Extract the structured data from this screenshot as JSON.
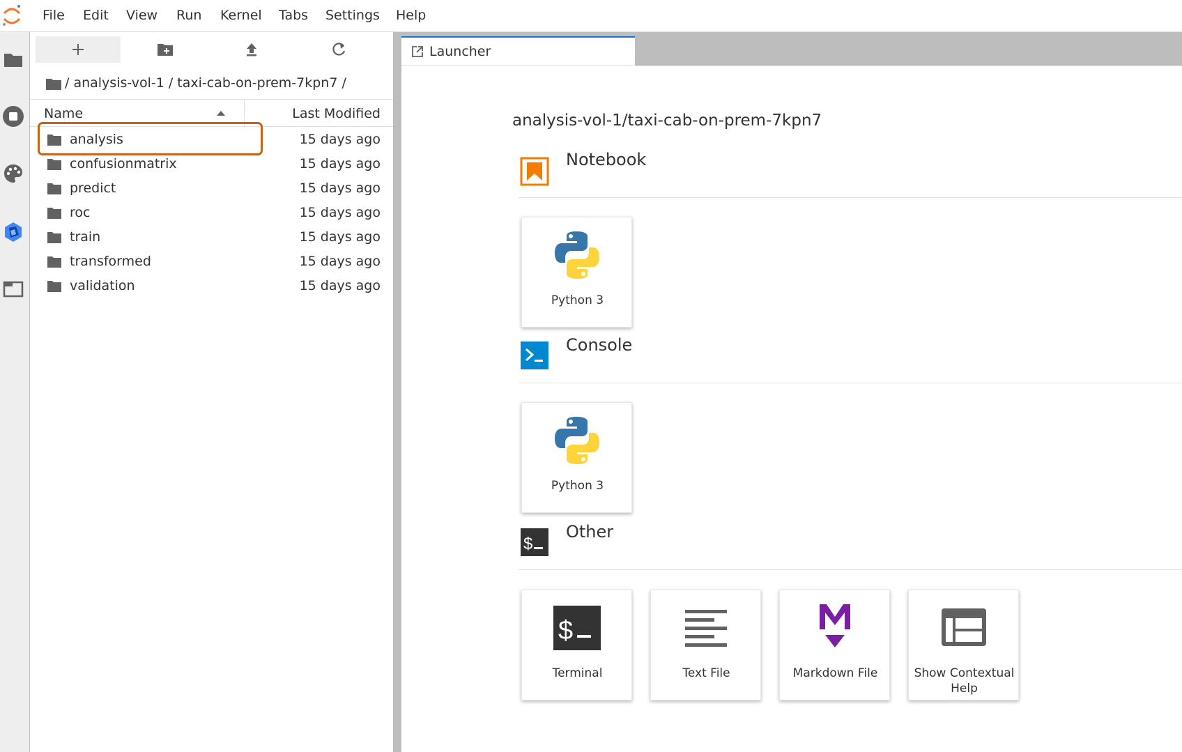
{
  "menubar": {
    "items": [
      "File",
      "Edit",
      "View",
      "Run",
      "Kernel",
      "Tabs",
      "Settings",
      "Help"
    ]
  },
  "activity_bar": {
    "icons": [
      "folder-icon",
      "running-icon",
      "palette-icon",
      "kubeflow-icon",
      "tabs-icon"
    ]
  },
  "file_browser": {
    "toolbar": [
      "new-launcher-icon",
      "new-folder-icon",
      "upload-icon",
      "refresh-icon"
    ],
    "breadcrumb": "/ analysis-vol-1 / taxi-cab-on-prem-7kpn7 /",
    "header": {
      "name": "Name",
      "modified": "Last Modified"
    },
    "items": [
      {
        "name": "analysis",
        "modified": "15 days ago"
      },
      {
        "name": "confusionmatrix",
        "modified": "15 days ago"
      },
      {
        "name": "predict",
        "modified": "15 days ago"
      },
      {
        "name": "roc",
        "modified": "15 days ago"
      },
      {
        "name": "train",
        "modified": "15 days ago"
      },
      {
        "name": "transformed",
        "modified": "15 days ago"
      },
      {
        "name": "validation",
        "modified": "15 days ago"
      }
    ],
    "highlighted_item": "analysis"
  },
  "tabs": [
    {
      "label": "Launcher"
    }
  ],
  "launcher": {
    "cwd": "analysis-vol-1/taxi-cab-on-prem-7kpn7",
    "sections": {
      "notebook": {
        "title": "Notebook",
        "cards": [
          "Python 3"
        ]
      },
      "console": {
        "title": "Console",
        "cards": [
          "Python 3"
        ]
      },
      "other": {
        "title": "Other",
        "cards": [
          "Terminal",
          "Text File",
          "Markdown File",
          "Show Contextual Help"
        ]
      }
    }
  },
  "colors": {
    "highlight": "#c0651a",
    "notebook_orange": "#f57c00",
    "console_blue": "#0288d1",
    "markdown_purple": "#7b1fa2",
    "tab_accent": "#1976d2"
  }
}
